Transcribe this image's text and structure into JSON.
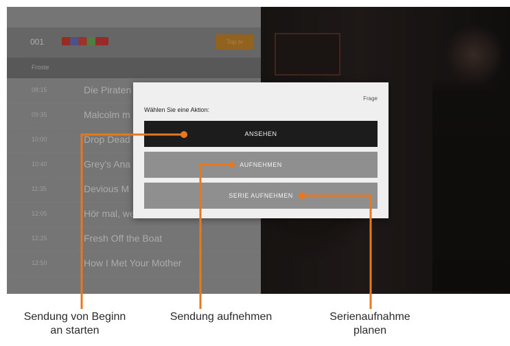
{
  "channel": {
    "number": "001",
    "logo_name": "channel-logo",
    "button_label": "Top tv"
  },
  "epg": {
    "day_label": "Froste",
    "rows": [
      {
        "time": "08:15",
        "title": "Die Piraten"
      },
      {
        "time": "09:35",
        "title": "Malcolm m"
      },
      {
        "time": "10:00",
        "title": "Drop Dead"
      },
      {
        "time": "10:40",
        "title": "Grey's Ana"
      },
      {
        "time": "11:35",
        "title": "Devious M"
      },
      {
        "time": "12:05",
        "title": "Hör mal, wer da hämmert"
      },
      {
        "time": "12:25",
        "title": "Fresh Off the Boat"
      },
      {
        "time": "12:50",
        "title": "How I Met Your Mother"
      }
    ]
  },
  "dialog": {
    "corner_label": "Frage",
    "prompt": "Wählen Sie eine Aktion:",
    "watch_label": "ANSEHEN",
    "record_label": "AUFNEHMEN",
    "series_label": "SERIE AUFNEHMEN"
  },
  "captions": {
    "watch_line1": "Sendung von Beginn",
    "watch_line2": "an starten",
    "record": "Sendung aufnehmen",
    "series_line1": "Serienaufnahme",
    "series_line2": "planen"
  },
  "colors": {
    "accent": "#e8771e",
    "dialog_bg": "#efefef",
    "selected_button": "#1c1c1c",
    "button": "#8f8f8f"
  }
}
